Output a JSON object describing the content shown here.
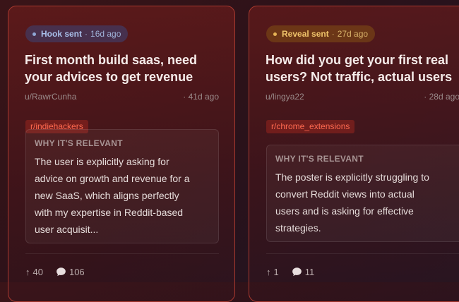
{
  "cards": [
    {
      "badge": {
        "status": "Hook sent",
        "age": "16d ago"
      },
      "title_lines": [
        "First month build saas, need",
        "your advices to get revenue"
      ],
      "author": "u/RawrCunha",
      "time": "· 41d ago",
      "subreddit": "r/indiehackers",
      "why_heading": "WHY IT'S RELEVANT",
      "why_lines": [
        "The user is explicitly asking for",
        "advice on growth and revenue for a",
        "new SaaS, which aligns perfectly",
        "with my expertise in Reddit-based",
        "user acquisit..."
      ],
      "upvotes": "40",
      "comments": "106"
    },
    {
      "badge": {
        "status": "Reveal sent",
        "age": "27d ago"
      },
      "title_lines": [
        "How did you get your first real",
        "users? Not traffic, actual users"
      ],
      "author": "u/lingya22",
      "time": "· 28d ago",
      "subreddit": "r/chrome_extensions",
      "why_heading": "WHY IT'S RELEVANT",
      "why_lines": [
        "The poster is explicitly struggling to",
        "convert Reddit views into actual",
        "users and is asking for effective",
        "strategies."
      ],
      "upvotes": "1",
      "comments": "11"
    }
  ],
  "colors": {
    "accent_border": "#a8392f",
    "hook": "#a9bfea",
    "reveal": "#efc36a",
    "subreddit": "#ff6a50"
  },
  "icons": {
    "status_dot": "dot-icon",
    "upvote": "arrow-up-icon",
    "comments": "speech-bubble-icon"
  }
}
